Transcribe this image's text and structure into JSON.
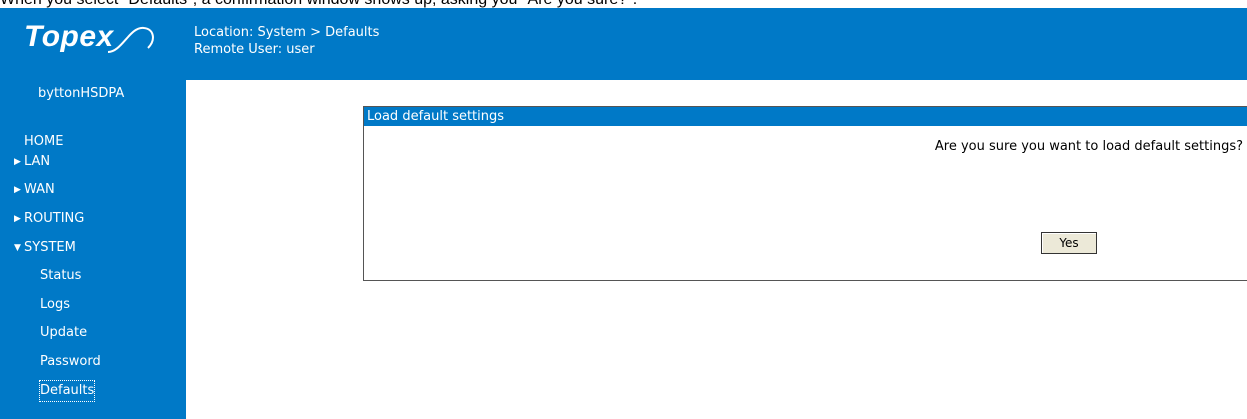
{
  "caption": "When you select \"Defaults\", a confirmation window shows up, asking you \"Are you sure?\".",
  "header": {
    "logo_text": "Topex",
    "location": "Location: System > Defaults",
    "remote_user": "Remote User: user"
  },
  "sidebar": {
    "device_name": "byttonHSDPA",
    "items": [
      {
        "label": "HOME",
        "arrow": ""
      },
      {
        "label": "LAN",
        "arrow": "▶"
      },
      {
        "label": "WAN",
        "arrow": "▶"
      },
      {
        "label": "ROUTING",
        "arrow": "▶"
      },
      {
        "label": "SYSTEM",
        "arrow": "▼"
      }
    ],
    "sub_items": [
      {
        "label": "Status"
      },
      {
        "label": "Logs"
      },
      {
        "label": "Update"
      },
      {
        "label": "Password"
      },
      {
        "label": "Defaults"
      }
    ]
  },
  "dialog": {
    "title": "Load default settings",
    "question": "Are you sure you want to load default settings?",
    "yes_label": "Yes"
  },
  "colors": {
    "brand_blue": "#0079c7"
  }
}
